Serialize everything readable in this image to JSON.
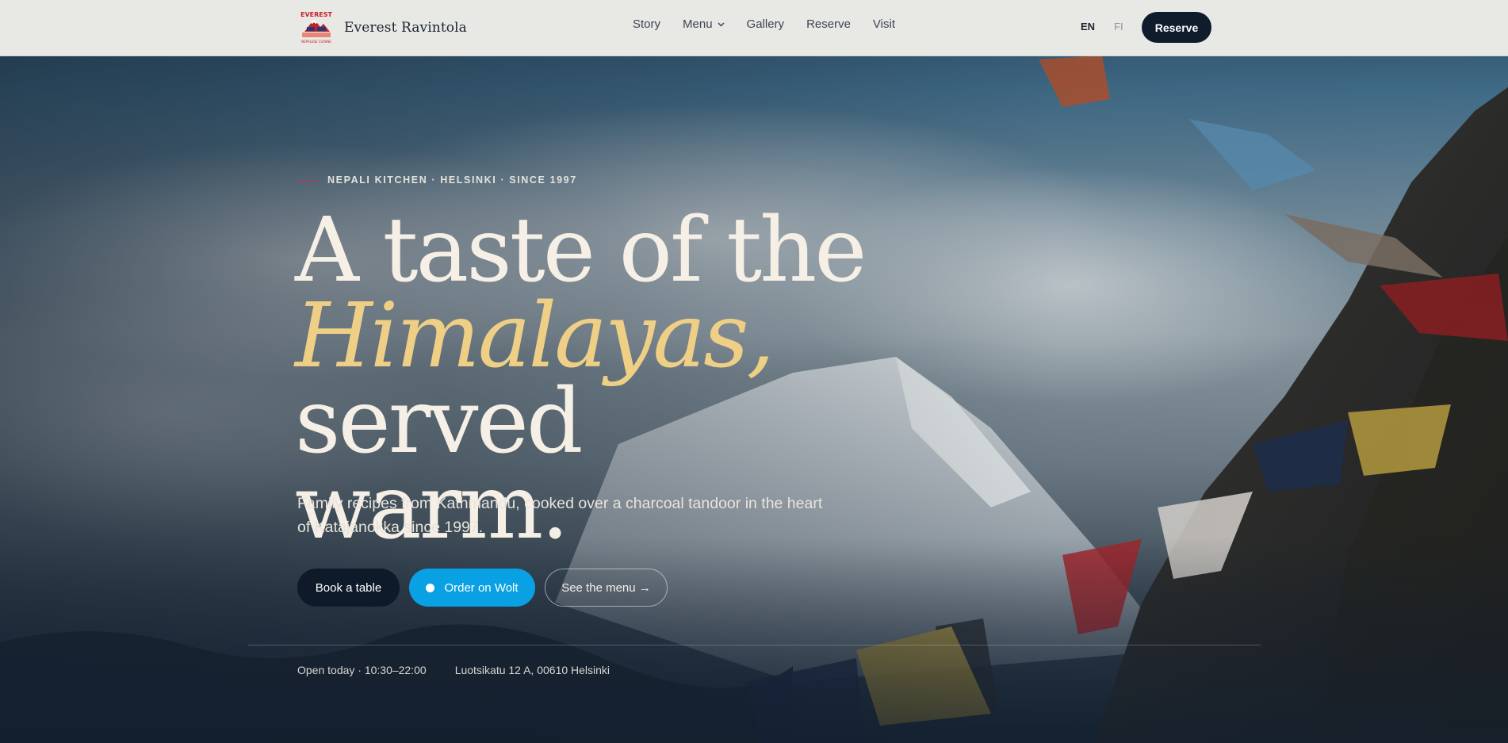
{
  "colors": {
    "header_bg": "#e8e8e5",
    "navy": "#0f1c2c",
    "gold_accent": "#efcf86",
    "wolt_blue": "#0aa0e4",
    "eyebrow_rule": "#c0394a"
  },
  "header": {
    "logo": {
      "icon": "everest-logo-icon",
      "top_text": "EVEREST",
      "bottom_text": "NEPALESE CUISINE"
    },
    "brand_name": "Everest Ravintola",
    "nav": [
      {
        "label": "Story"
      },
      {
        "label": "Menu",
        "has_dropdown": true,
        "icon": "chevron-down-icon"
      },
      {
        "label": "Gallery"
      },
      {
        "label": "Reserve"
      },
      {
        "label": "Visit"
      }
    ],
    "languages": {
      "active": "EN",
      "inactive": "FI"
    },
    "reserve_button": "Reserve"
  },
  "hero": {
    "eyebrow": "NEPALI KITCHEN · HELSINKI · SINCE 1997",
    "headline": {
      "line1": "A taste of the",
      "accent": "Himalayas,",
      "line2_rest": " served",
      "line3": "warm."
    },
    "lede": "Family recipes from Kathmandu, cooked over a charcoal tandoor in the heart of Katajanokka since 1997.",
    "buttons": {
      "book": "Book a table",
      "wolt": "Order on Wolt",
      "menu": "See the menu →"
    },
    "meta": {
      "hours": "Open today · 10:30–22:00",
      "address": "Luotsikatu 12 A, 00610 Helsinki"
    }
  }
}
